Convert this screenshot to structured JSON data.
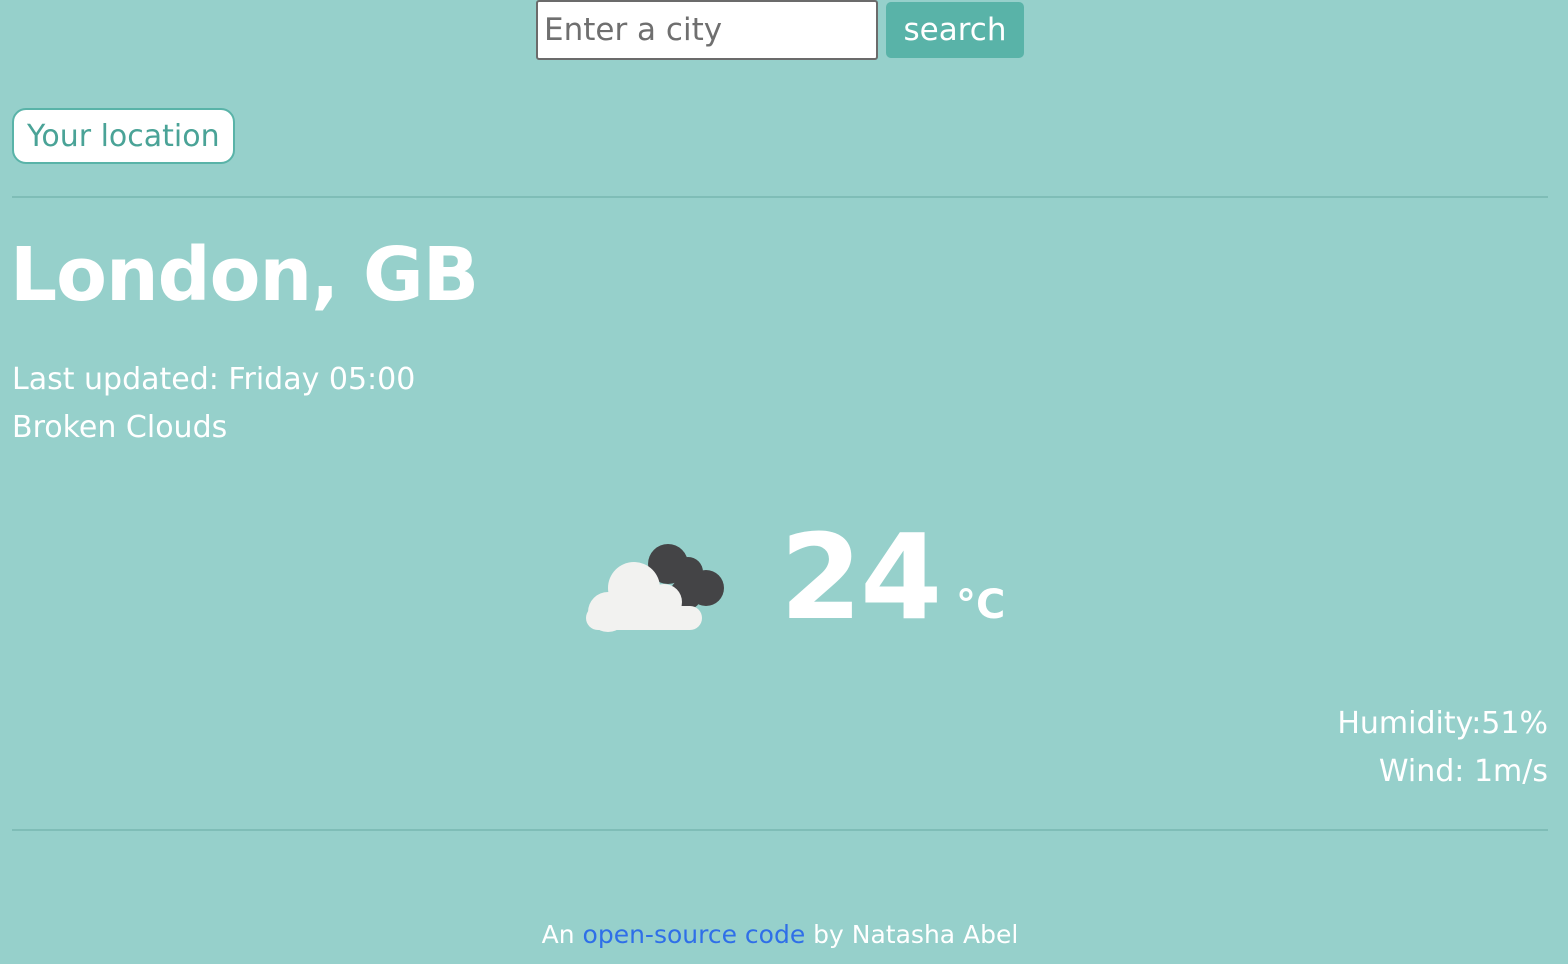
{
  "search": {
    "placeholder": "Enter a city",
    "value": "",
    "button_label": "search"
  },
  "location_button": {
    "label": "Your location"
  },
  "weather": {
    "city": "London, GB",
    "last_updated": "Last updated: Friday 05:00",
    "description": "Broken Clouds",
    "icon": "broken-clouds-icon",
    "temperature": "24",
    "unit": "°C",
    "humidity": "Humidity:51%",
    "wind": "Wind: 1m/s"
  },
  "footer": {
    "prefix": "An ",
    "link_text": "open-source code",
    "suffix": " by Natasha Abel"
  },
  "colors": {
    "background": "#96d0cb",
    "accent": "#59b3a8",
    "link": "#2f6fe8"
  }
}
